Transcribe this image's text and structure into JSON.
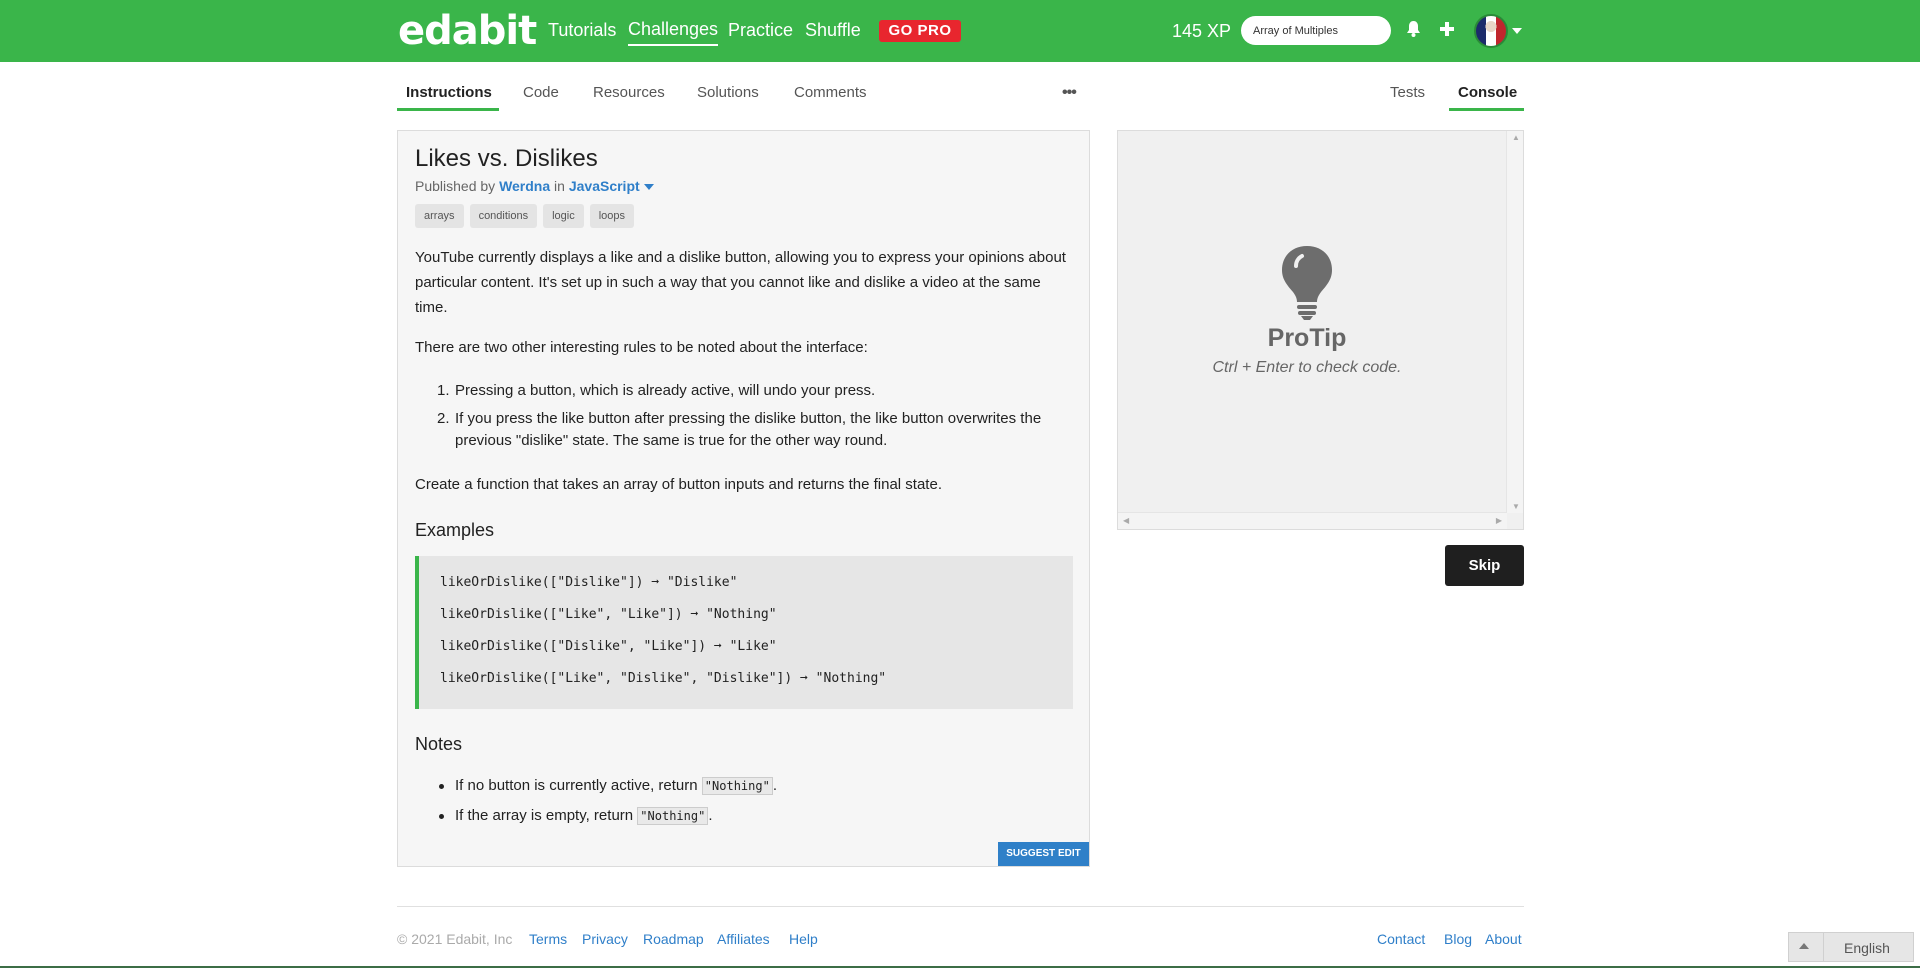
{
  "brand": {
    "logo": "edabit",
    "accent": "#3ab54a"
  },
  "nav": {
    "links": [
      "Tutorials",
      "Challenges",
      "Practice",
      "Shuffle"
    ],
    "active": "Challenges",
    "gopro": "GO PRO",
    "xp": "145 XP",
    "search_value": "Array of Multiples"
  },
  "tabs": {
    "left": [
      "Instructions",
      "Code",
      "Resources",
      "Solutions",
      "Comments"
    ],
    "more": "•••",
    "right": [
      "Tests",
      "Console"
    ]
  },
  "challenge": {
    "title": "Likes vs. Dislikes",
    "published_by": "Published by",
    "author": "Werdna",
    "in": "in",
    "language": "JavaScript",
    "tags": [
      "arrays",
      "conditions",
      "logic",
      "loops"
    ],
    "para1": "YouTube currently displays a like and a dislike button, allowing you to express your opinions about particular content. It's set up in such a way that you cannot like and dislike a video at the same time.",
    "para2": "There are two other interesting rules to be noted about the interface:",
    "rules": [
      "Pressing a button, which is already active, will undo your press.",
      "If you press the like button after pressing the dislike button, the like button overwrites the previous \"dislike\" state. The same is true for the other way round."
    ],
    "para3": "Create a function that takes an array of button inputs and returns the final state.",
    "examples_heading": "Examples",
    "examples": [
      "likeOrDislike([\"Dislike\"]) ➞ \"Dislike\"",
      "likeOrDislike([\"Like\", \"Like\"]) ➞ \"Nothing\"",
      "likeOrDislike([\"Dislike\", \"Like\"]) ➞ \"Like\"",
      "likeOrDislike([\"Like\", \"Dislike\", \"Dislike\"]) ➞ \"Nothing\""
    ],
    "notes_heading": "Notes",
    "notes": [
      {
        "text": "If no button is currently active, return ",
        "code": "\"Nothing\"",
        "end": "."
      },
      {
        "text": "If the array is empty, return ",
        "code": "\"Nothing\"",
        "end": "."
      }
    ],
    "suggest_edit": "SUGGEST EDIT"
  },
  "console": {
    "protip": "ProTip",
    "hint": "Ctrl + Enter to check code.",
    "skip": "Skip"
  },
  "footer": {
    "copyright": "© 2021 Edabit, Inc",
    "left_links": [
      "Terms",
      "Privacy",
      "Roadmap",
      "Affiliates",
      "Help"
    ],
    "right_links": [
      "Contact",
      "Blog",
      "About"
    ],
    "language": "English"
  }
}
